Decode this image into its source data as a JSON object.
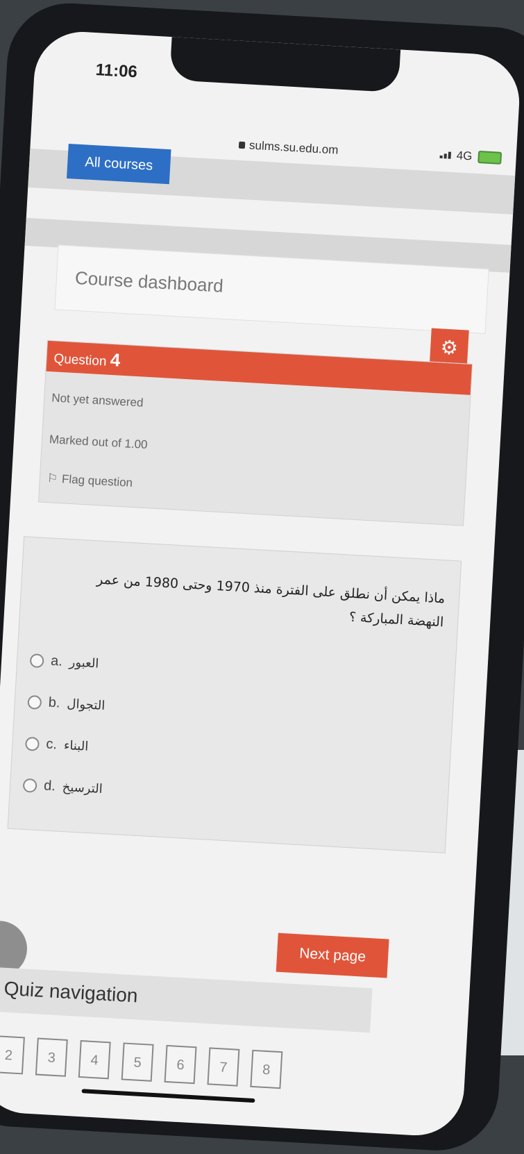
{
  "status_bar": {
    "time": "11:06",
    "network": "4G"
  },
  "browser": {
    "url": "sulms.su.edu.om"
  },
  "header": {
    "all_courses": "All courses"
  },
  "course_dashboard": {
    "label": "Course dashboard"
  },
  "question_info": {
    "prefix": "Question",
    "number": "4",
    "state": "Not yet answered",
    "marks": "Marked out of 1.00",
    "flag": "Flag question"
  },
  "question": {
    "text": "ماذا يمكن أن نطلق على الفترة منذ 1970 وحتى 1980 من عمر النهضة المباركة ؟",
    "options": [
      {
        "letter": "a.",
        "text": "العبور"
      },
      {
        "letter": "b.",
        "text": "التجوال"
      },
      {
        "letter": "c.",
        "text": "البناء"
      },
      {
        "letter": "d.",
        "text": "الترسيخ"
      }
    ]
  },
  "next_page": "Next page",
  "quiz_navigation": {
    "title": "Quiz navigation",
    "buttons": [
      "2",
      "3",
      "4",
      "5",
      "6",
      "7",
      "8"
    ]
  },
  "colors": {
    "accent": "#e0553a",
    "primary": "#2d6fc4"
  }
}
